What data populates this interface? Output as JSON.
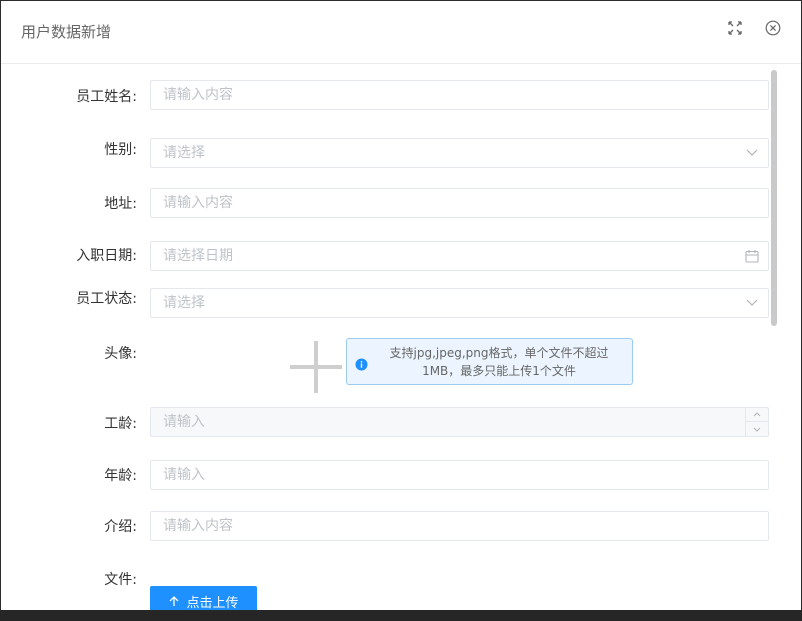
{
  "dialog": {
    "title": "用户数据新增",
    "maximize_icon": "maximize-icon",
    "close_icon": "close-circle-icon"
  },
  "form": {
    "name": {
      "label": "员工姓名:",
      "placeholder": "请输入内容"
    },
    "gender": {
      "label": "性别:",
      "placeholder": "请选择"
    },
    "address": {
      "label": "地址:",
      "placeholder": "请输入内容"
    },
    "join_date": {
      "label": "入职日期:",
      "placeholder": "请选择日期"
    },
    "status": {
      "label": "员工状态:",
      "placeholder": "请选择"
    },
    "avatar": {
      "label": "头像:",
      "tip_line1": "支持jpg,jpeg,png格式，单个文件不超过",
      "tip_line2": "1MB，最多只能上传1个文件"
    },
    "seniority": {
      "label": "工龄:",
      "placeholder": "请输入"
    },
    "age": {
      "label": "年龄:",
      "placeholder": "请输入"
    },
    "intro": {
      "label": "介绍:",
      "placeholder": "请输入内容"
    },
    "file": {
      "label": "文件:",
      "button_label": "点击上传"
    }
  },
  "colors": {
    "primary": "#1e90ff",
    "tip_bg": "#ecf5ff",
    "tip_border": "#9ccbf2",
    "border": "#e4e7ed",
    "placeholder": "#bfc3c9"
  }
}
